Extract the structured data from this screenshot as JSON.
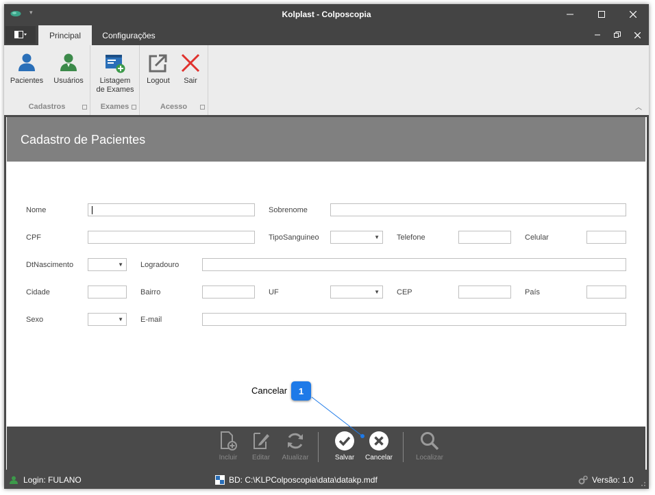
{
  "window": {
    "title": "Kolplast - Colposcopia"
  },
  "tabs": {
    "principal": "Principal",
    "config": "Configurações"
  },
  "ribbon": {
    "groups": {
      "cadastros": "Cadastros",
      "exames": "Exames",
      "acesso": "Acesso"
    },
    "buttons": {
      "pacientes": "Pacientes",
      "usuarios": "Usuários",
      "listagem": "Listagem\nde Exames",
      "logout": "Logout",
      "sair": "Sair"
    }
  },
  "form": {
    "title": "Cadastro de Pacientes",
    "labels": {
      "nome": "Nome",
      "sobrenome": "Sobrenome",
      "cpf": "CPF",
      "tipo_sanguineo": "TipoSanguineo",
      "telefone": "Telefone",
      "celular": "Celular",
      "dt_nascimento": "DtNascimento",
      "logradouro": "Logradouro",
      "cidade": "Cidade",
      "bairro": "Bairro",
      "uf": "UF",
      "cep": "CEP",
      "pais": "País",
      "sexo": "Sexo",
      "email": "E-mail"
    }
  },
  "toolbar": {
    "incluir": "Incluir",
    "editar": "Editar",
    "atualizar": "Atualizar",
    "salvar": "Salvar",
    "cancelar": "Cancelar",
    "localizar": "Localizar"
  },
  "callout": {
    "text": "Cancelar",
    "number": "1"
  },
  "status": {
    "login": "Login: FULANO",
    "db": "BD: C:\\KLPColposcopia\\data\\datakp.mdf",
    "version": "Versão: 1.0"
  },
  "colors": {
    "accent_blue": "#2a6fb8",
    "user_green": "#3c8a4a",
    "exit_red": "#e0312d",
    "callout_blue": "#1e7ae8"
  }
}
